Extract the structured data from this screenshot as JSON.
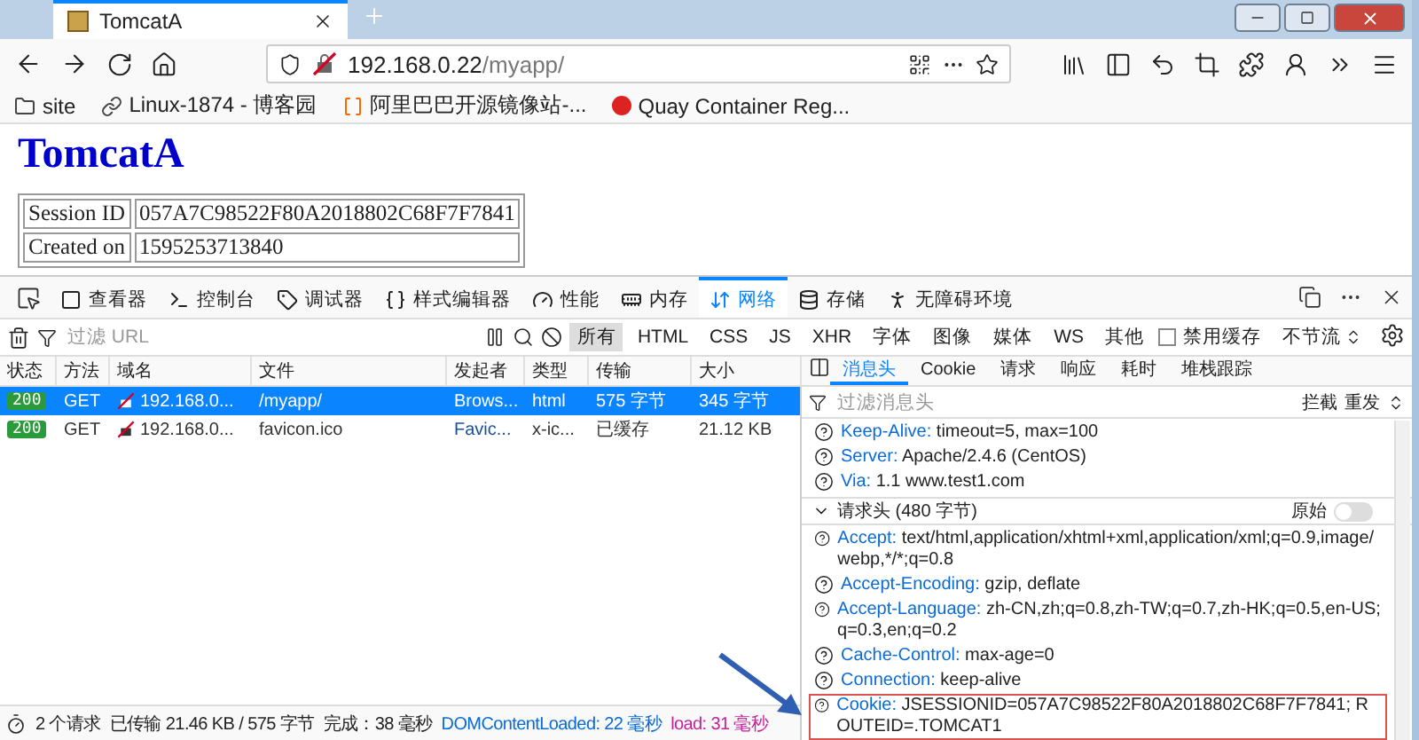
{
  "browser": {
    "tab_title": "TomcatA",
    "url_host": "192.168.0.22",
    "url_path": "/myapp/",
    "bookmarks": [
      "site",
      "Linux-1874 - 博客园",
      "阿里巴巴开源镜像站-...",
      "Quay Container Reg..."
    ]
  },
  "page": {
    "heading": "TomcatA",
    "table": [
      [
        "Session ID",
        "057A7C98522F80A2018802C68F7F7841"
      ],
      [
        "Created on",
        "1595253713840"
      ]
    ]
  },
  "devtools": {
    "tabs": [
      {
        "label": "查看器",
        "selected": false
      },
      {
        "label": "控制台",
        "selected": false
      },
      {
        "label": "调试器",
        "selected": false
      },
      {
        "label": "样式编辑器",
        "selected": false
      },
      {
        "label": "性能",
        "selected": false
      },
      {
        "label": "内存",
        "selected": false
      },
      {
        "label": "网络",
        "selected": true
      },
      {
        "label": "存储",
        "selected": false
      },
      {
        "label": "无障碍环境",
        "selected": false
      }
    ],
    "filter_placeholder": "过滤 URL",
    "type_filters": [
      {
        "label": "所有",
        "selected": true
      },
      {
        "label": "HTML",
        "selected": false
      },
      {
        "label": "CSS",
        "selected": false
      },
      {
        "label": "JS",
        "selected": false
      },
      {
        "label": "XHR",
        "selected": false
      },
      {
        "label": "字体",
        "selected": false
      },
      {
        "label": "图像",
        "selected": false
      },
      {
        "label": "媒体",
        "selected": false
      },
      {
        "label": "WS",
        "selected": false
      },
      {
        "label": "其他",
        "selected": false
      }
    ],
    "disable_cache": {
      "label": "禁用缓存",
      "checked": false
    },
    "throttle": "不节流",
    "columns": [
      "状态",
      "方法",
      "域名",
      "文件",
      "发起者",
      "类型",
      "传输",
      "大小"
    ],
    "requests": [
      {
        "status": "200",
        "method": "GET",
        "domain": "192.168.0...",
        "file": "/myapp/",
        "initiator": "Brows...",
        "type": "html",
        "transferred": "575 字节",
        "size": "345 字节",
        "selected": true
      },
      {
        "status": "200",
        "method": "GET",
        "domain": "192.168.0...",
        "file": "favicon.ico",
        "initiator": "Favic...",
        "type": "x-ic...",
        "transferred": "已缓存",
        "size": "21.12 KB",
        "selected": false
      }
    ],
    "status_bar": {
      "requests": "2 个请求",
      "transferred": "已传输 21.46 KB / 575 字节",
      "finish": "完成：38 毫秒",
      "dom_loaded": "DOMContentLoaded: 22 毫秒",
      "load": "load: 31 毫秒"
    },
    "detail_tabs": [
      {
        "label": "消息头",
        "selected": true
      },
      {
        "label": "Cookie",
        "selected": false
      },
      {
        "label": "请求",
        "selected": false
      },
      {
        "label": "响应",
        "selected": false
      },
      {
        "label": "耗时",
        "selected": false
      },
      {
        "label": "堆栈跟踪",
        "selected": false
      }
    ],
    "header_filter_placeholder": "过滤消息头",
    "block_button": "拦截",
    "resend_button": "重发",
    "response_headers": [
      {
        "name": "Keep-Alive:",
        "value": "timeout=5, max=100"
      },
      {
        "name": "Server:",
        "value": "Apache/2.4.6 (CentOS)"
      },
      {
        "name": "Via:",
        "value": "1.1 www.test1.com"
      }
    ],
    "request_section": {
      "title": "请求头 (480 字节)",
      "expanded": true,
      "raw_label": "原始",
      "raw_on": false
    },
    "request_headers": [
      {
        "name": "Accept:",
        "value": "text/html,application/xhtml+xml,application/xml;q=0.9,image/webp,*/*;q=0.8",
        "highlighted": false
      },
      {
        "name": "Accept-Encoding:",
        "value": "gzip, deflate",
        "highlighted": false
      },
      {
        "name": "Accept-Language:",
        "value": "zh-CN,zh;q=0.8,zh-TW;q=0.7,zh-HK;q=0.5,en-US;q=0.3,en;q=0.2",
        "highlighted": false
      },
      {
        "name": "Cache-Control:",
        "value": "max-age=0",
        "highlighted": false
      },
      {
        "name": "Connection:",
        "value": "keep-alive",
        "highlighted": false
      },
      {
        "name": "Cookie:",
        "value": "JSESSIONID=057A7C98522F80A2018802C68F7F7841; ROUTEID=.TOMCAT1",
        "highlighted": true
      }
    ]
  }
}
